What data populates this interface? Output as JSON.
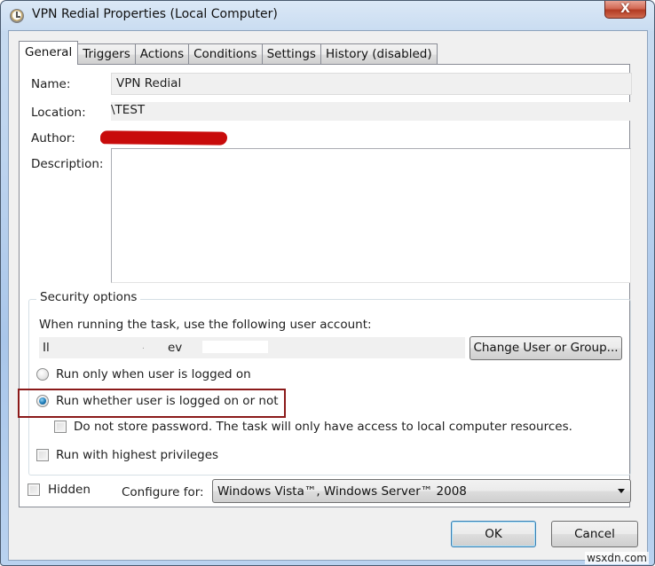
{
  "window": {
    "title": "VPN Redial Properties (Local Computer)",
    "app_icon": "clock-icon",
    "close_label": "X"
  },
  "tabs": [
    {
      "label": "General",
      "active": true
    },
    {
      "label": "Triggers",
      "active": false
    },
    {
      "label": "Actions",
      "active": false
    },
    {
      "label": "Conditions",
      "active": false
    },
    {
      "label": "Settings",
      "active": false
    },
    {
      "label": "History (disabled)",
      "active": false
    }
  ],
  "general": {
    "name_label": "Name:",
    "name_value": "VPN Redial",
    "location_label": "Location:",
    "location_value": "\\TEST",
    "author_label": "Author:",
    "author_value": "[redacted]",
    "description_label": "Description:",
    "description_value": ""
  },
  "security": {
    "group_title": "Security options",
    "account_prompt": "When running the task, use the following user account:",
    "account_value_part1": "Il",
    "account_value_part2": ".",
    "account_value_part3": "ev",
    "change_user_button": "Change User or Group...",
    "radio_logged_on": {
      "label": "Run only when user is logged on",
      "checked": false
    },
    "radio_whether": {
      "label": "Run whether user is logged on or not",
      "checked": true
    },
    "checkbox_no_password": {
      "label": "Do not store password.  The task will only have access to local computer resources.",
      "checked": false
    },
    "checkbox_highest": {
      "label": "Run with highest privileges",
      "checked": false
    }
  },
  "footer": {
    "hidden_label": "Hidden",
    "hidden_checked": false,
    "configure_label": "Configure for:",
    "configure_value": "Windows Vista™, Windows Server™ 2008"
  },
  "buttons": {
    "ok": "OK",
    "cancel": "Cancel"
  },
  "watermark": "wsxdn.com"
}
